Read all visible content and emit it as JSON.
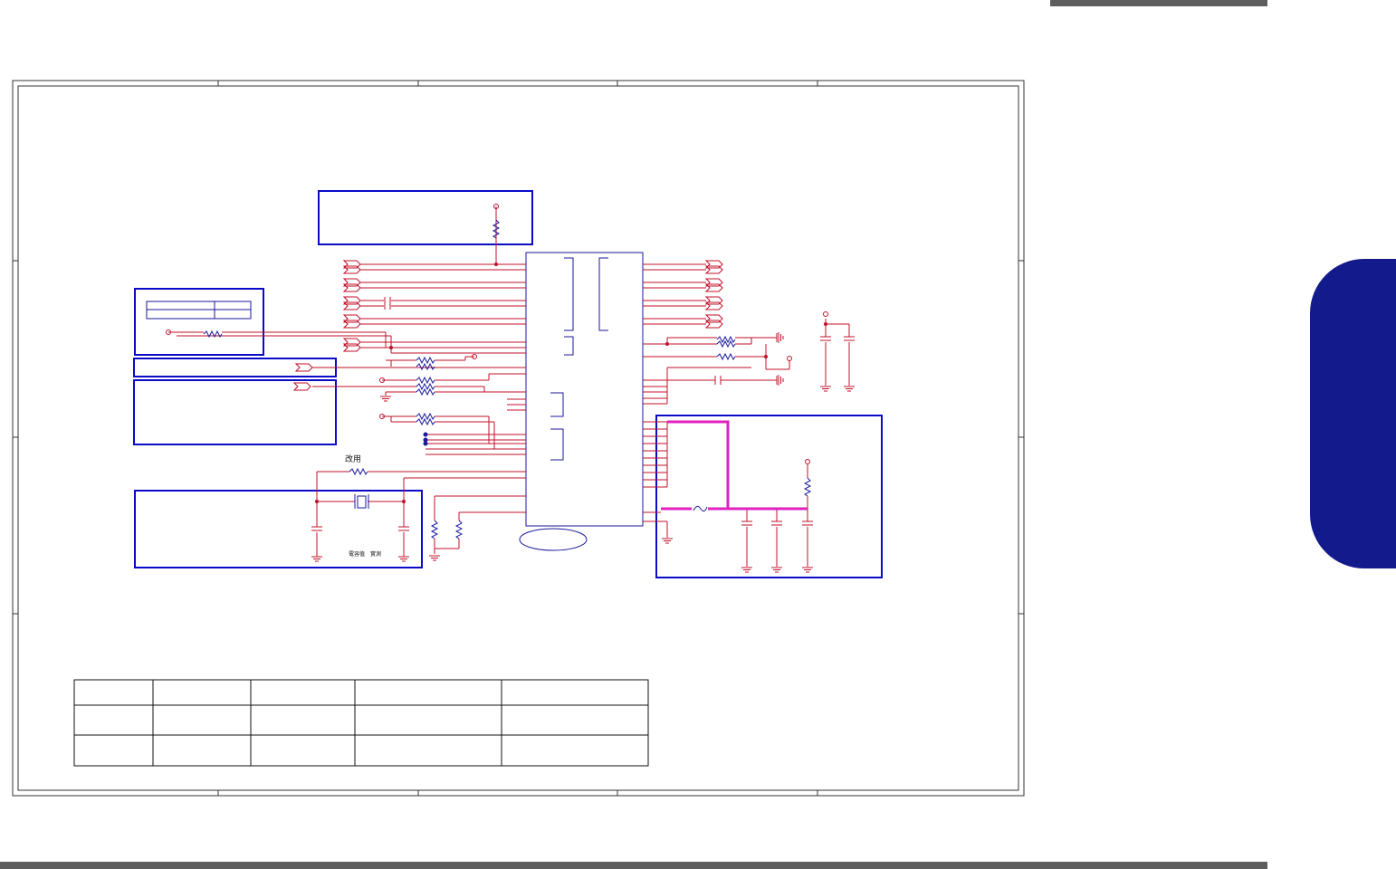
{
  "notes": {
    "crystal_label": "改用",
    "cap_note": "電容值　實測"
  },
  "revision_table": {
    "rows": [
      [
        "",
        "",
        "",
        "",
        ""
      ],
      [
        "",
        "",
        "",
        "",
        ""
      ],
      [
        "",
        "",
        "",
        "",
        ""
      ]
    ]
  },
  "colors": {
    "wire": "#c0102a",
    "frame": "#0a0ac8",
    "net_highlight": "#e020c0",
    "side_tab": "#131a8c",
    "bar": "#5e5e5e"
  }
}
